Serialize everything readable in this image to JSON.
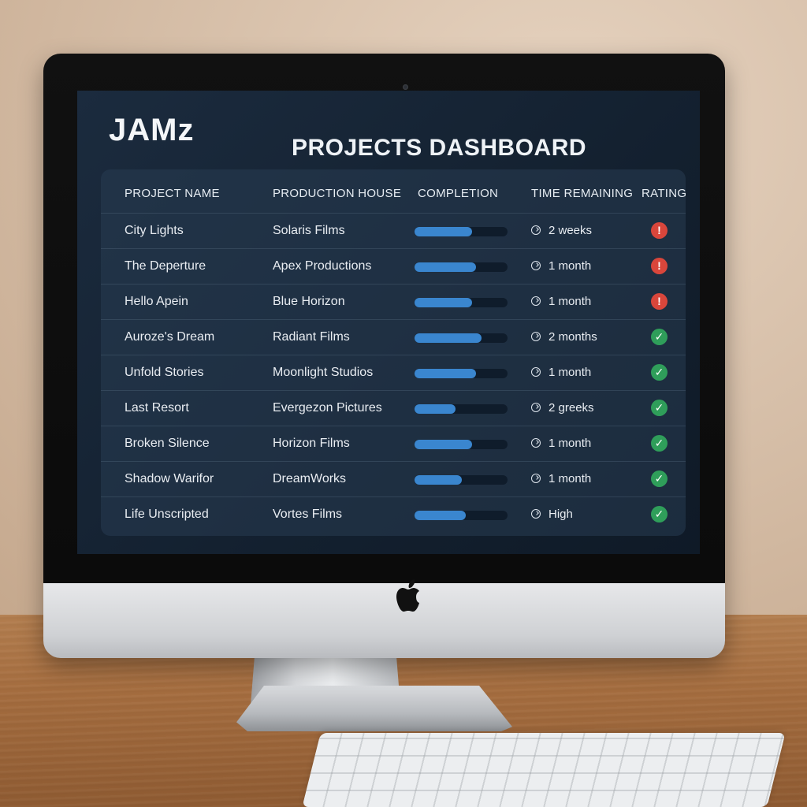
{
  "app": {
    "brand": "JAMz",
    "title": "PROJECTS DASHBOARD"
  },
  "table": {
    "headers": {
      "project": "PROJECT NAME",
      "house": "PRODUCTION HOUSE",
      "completion": "COMPLETION",
      "time": "TIME REMAINING",
      "rating": "RATING"
    },
    "rows": [
      {
        "project": "City Lights",
        "house": "Solaris Films",
        "completion": 0.62,
        "time": "2 weeks",
        "rating": "alert"
      },
      {
        "project": "The Deperture",
        "house": "Apex Productions",
        "completion": 0.66,
        "time": "1 month",
        "rating": "alert"
      },
      {
        "project": "Hello Apein",
        "house": "Blue Horizon",
        "completion": 0.62,
        "time": "1 month",
        "rating": "alert"
      },
      {
        "project": "Auroze's Dream",
        "house": "Radiant Films",
        "completion": 0.72,
        "time": "2 months",
        "rating": "ok"
      },
      {
        "project": "Unfold Stories",
        "house": "Moonlight Studios",
        "completion": 0.66,
        "time": "1 month",
        "rating": "ok"
      },
      {
        "project": "Last Resort",
        "house": "Evergezon Pictures",
        "completion": 0.44,
        "time": "2 greeks",
        "rating": "ok"
      },
      {
        "project": "Broken Silence",
        "house": "Horizon Films",
        "completion": 0.62,
        "time": "1 month",
        "rating": "ok"
      },
      {
        "project": "Shadow Warifor",
        "house": "DreamWorks",
        "completion": 0.51,
        "time": "1 month",
        "rating": "ok"
      },
      {
        "project": "Life Unscripted",
        "house": "Vortes Films",
        "completion": 0.55,
        "time": "High",
        "rating": "ok"
      }
    ]
  },
  "icons": {
    "time": "clock-icon",
    "alert": "alert-icon",
    "ok": "check-icon",
    "apple": "apple-logo-icon"
  },
  "colors": {
    "alert": "#d9463b",
    "ok": "#2f9e5a",
    "bar": "#3a86cf",
    "screen_bg": "#16253a"
  }
}
